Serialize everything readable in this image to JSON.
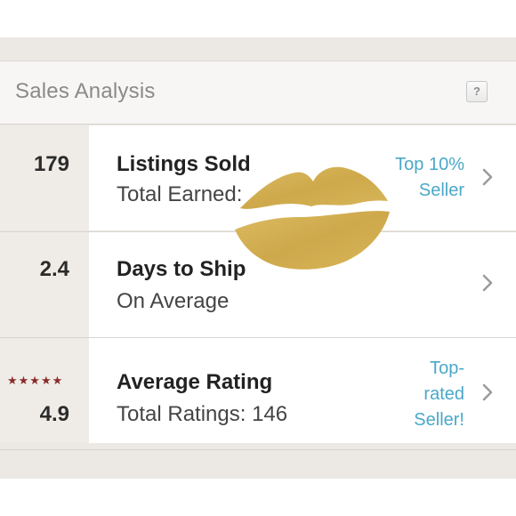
{
  "header": {
    "title": "Sales Analysis",
    "help_label": "?"
  },
  "rows": [
    {
      "value": "179",
      "title": "Listings Sold",
      "subtitle": "Total Earned:",
      "badge_lines": [
        "Top 10%",
        "Seller"
      ]
    },
    {
      "value": "2.4",
      "title": "Days to Ship",
      "subtitle": "On Average",
      "badge_lines": []
    },
    {
      "value": "4.9",
      "stars": "★★★★★",
      "star_rating": 5,
      "title": "Average Rating",
      "subtitle": "Total Ratings: 146",
      "badge_lines": [
        "Top-",
        "rated",
        "Seller!"
      ]
    }
  ],
  "colors": {
    "accent": "#4aa8c8",
    "star": "#8b2a2a",
    "lips_gold": "#d9b24a",
    "panel": "#ece9e4"
  },
  "icons": {
    "help": "help-icon",
    "chevron": "chevron-right-icon",
    "decoration": "gold-glitter-lips-icon"
  }
}
